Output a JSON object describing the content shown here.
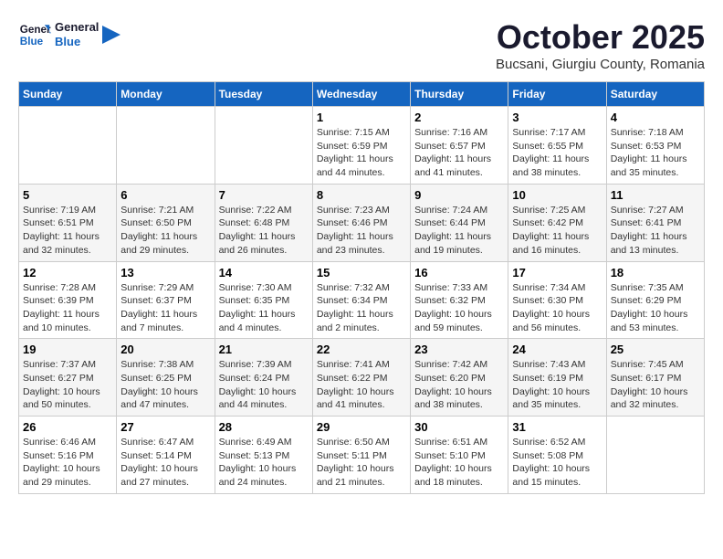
{
  "header": {
    "logo_general": "General",
    "logo_blue": "Blue",
    "month_title": "October 2025",
    "subtitle": "Bucsani, Giurgiu County, Romania"
  },
  "weekdays": [
    "Sunday",
    "Monday",
    "Tuesday",
    "Wednesday",
    "Thursday",
    "Friday",
    "Saturday"
  ],
  "weeks": [
    [
      {
        "day": "",
        "info": ""
      },
      {
        "day": "",
        "info": ""
      },
      {
        "day": "",
        "info": ""
      },
      {
        "day": "1",
        "sunrise": "7:15 AM",
        "sunset": "6:59 PM",
        "daylight": "11 hours and 44 minutes."
      },
      {
        "day": "2",
        "sunrise": "7:16 AM",
        "sunset": "6:57 PM",
        "daylight": "11 hours and 41 minutes."
      },
      {
        "day": "3",
        "sunrise": "7:17 AM",
        "sunset": "6:55 PM",
        "daylight": "11 hours and 38 minutes."
      },
      {
        "day": "4",
        "sunrise": "7:18 AM",
        "sunset": "6:53 PM",
        "daylight": "11 hours and 35 minutes."
      }
    ],
    [
      {
        "day": "5",
        "sunrise": "7:19 AM",
        "sunset": "6:51 PM",
        "daylight": "11 hours and 32 minutes."
      },
      {
        "day": "6",
        "sunrise": "7:21 AM",
        "sunset": "6:50 PM",
        "daylight": "11 hours and 29 minutes."
      },
      {
        "day": "7",
        "sunrise": "7:22 AM",
        "sunset": "6:48 PM",
        "daylight": "11 hours and 26 minutes."
      },
      {
        "day": "8",
        "sunrise": "7:23 AM",
        "sunset": "6:46 PM",
        "daylight": "11 hours and 23 minutes."
      },
      {
        "day": "9",
        "sunrise": "7:24 AM",
        "sunset": "6:44 PM",
        "daylight": "11 hours and 19 minutes."
      },
      {
        "day": "10",
        "sunrise": "7:25 AM",
        "sunset": "6:42 PM",
        "daylight": "11 hours and 16 minutes."
      },
      {
        "day": "11",
        "sunrise": "7:27 AM",
        "sunset": "6:41 PM",
        "daylight": "11 hours and 13 minutes."
      }
    ],
    [
      {
        "day": "12",
        "sunrise": "7:28 AM",
        "sunset": "6:39 PM",
        "daylight": "11 hours and 10 minutes."
      },
      {
        "day": "13",
        "sunrise": "7:29 AM",
        "sunset": "6:37 PM",
        "daylight": "11 hours and 7 minutes."
      },
      {
        "day": "14",
        "sunrise": "7:30 AM",
        "sunset": "6:35 PM",
        "daylight": "11 hours and 4 minutes."
      },
      {
        "day": "15",
        "sunrise": "7:32 AM",
        "sunset": "6:34 PM",
        "daylight": "11 hours and 2 minutes."
      },
      {
        "day": "16",
        "sunrise": "7:33 AM",
        "sunset": "6:32 PM",
        "daylight": "10 hours and 59 minutes."
      },
      {
        "day": "17",
        "sunrise": "7:34 AM",
        "sunset": "6:30 PM",
        "daylight": "10 hours and 56 minutes."
      },
      {
        "day": "18",
        "sunrise": "7:35 AM",
        "sunset": "6:29 PM",
        "daylight": "10 hours and 53 minutes."
      }
    ],
    [
      {
        "day": "19",
        "sunrise": "7:37 AM",
        "sunset": "6:27 PM",
        "daylight": "10 hours and 50 minutes."
      },
      {
        "day": "20",
        "sunrise": "7:38 AM",
        "sunset": "6:25 PM",
        "daylight": "10 hours and 47 minutes."
      },
      {
        "day": "21",
        "sunrise": "7:39 AM",
        "sunset": "6:24 PM",
        "daylight": "10 hours and 44 minutes."
      },
      {
        "day": "22",
        "sunrise": "7:41 AM",
        "sunset": "6:22 PM",
        "daylight": "10 hours and 41 minutes."
      },
      {
        "day": "23",
        "sunrise": "7:42 AM",
        "sunset": "6:20 PM",
        "daylight": "10 hours and 38 minutes."
      },
      {
        "day": "24",
        "sunrise": "7:43 AM",
        "sunset": "6:19 PM",
        "daylight": "10 hours and 35 minutes."
      },
      {
        "day": "25",
        "sunrise": "7:45 AM",
        "sunset": "6:17 PM",
        "daylight": "10 hours and 32 minutes."
      }
    ],
    [
      {
        "day": "26",
        "sunrise": "6:46 AM",
        "sunset": "5:16 PM",
        "daylight": "10 hours and 29 minutes."
      },
      {
        "day": "27",
        "sunrise": "6:47 AM",
        "sunset": "5:14 PM",
        "daylight": "10 hours and 27 minutes."
      },
      {
        "day": "28",
        "sunrise": "6:49 AM",
        "sunset": "5:13 PM",
        "daylight": "10 hours and 24 minutes."
      },
      {
        "day": "29",
        "sunrise": "6:50 AM",
        "sunset": "5:11 PM",
        "daylight": "10 hours and 21 minutes."
      },
      {
        "day": "30",
        "sunrise": "6:51 AM",
        "sunset": "5:10 PM",
        "daylight": "10 hours and 18 minutes."
      },
      {
        "day": "31",
        "sunrise": "6:52 AM",
        "sunset": "5:08 PM",
        "daylight": "10 hours and 15 minutes."
      },
      {
        "day": "",
        "info": ""
      }
    ]
  ],
  "labels": {
    "sunrise_label": "Sunrise:",
    "sunset_label": "Sunset:",
    "daylight_label": "Daylight:"
  }
}
